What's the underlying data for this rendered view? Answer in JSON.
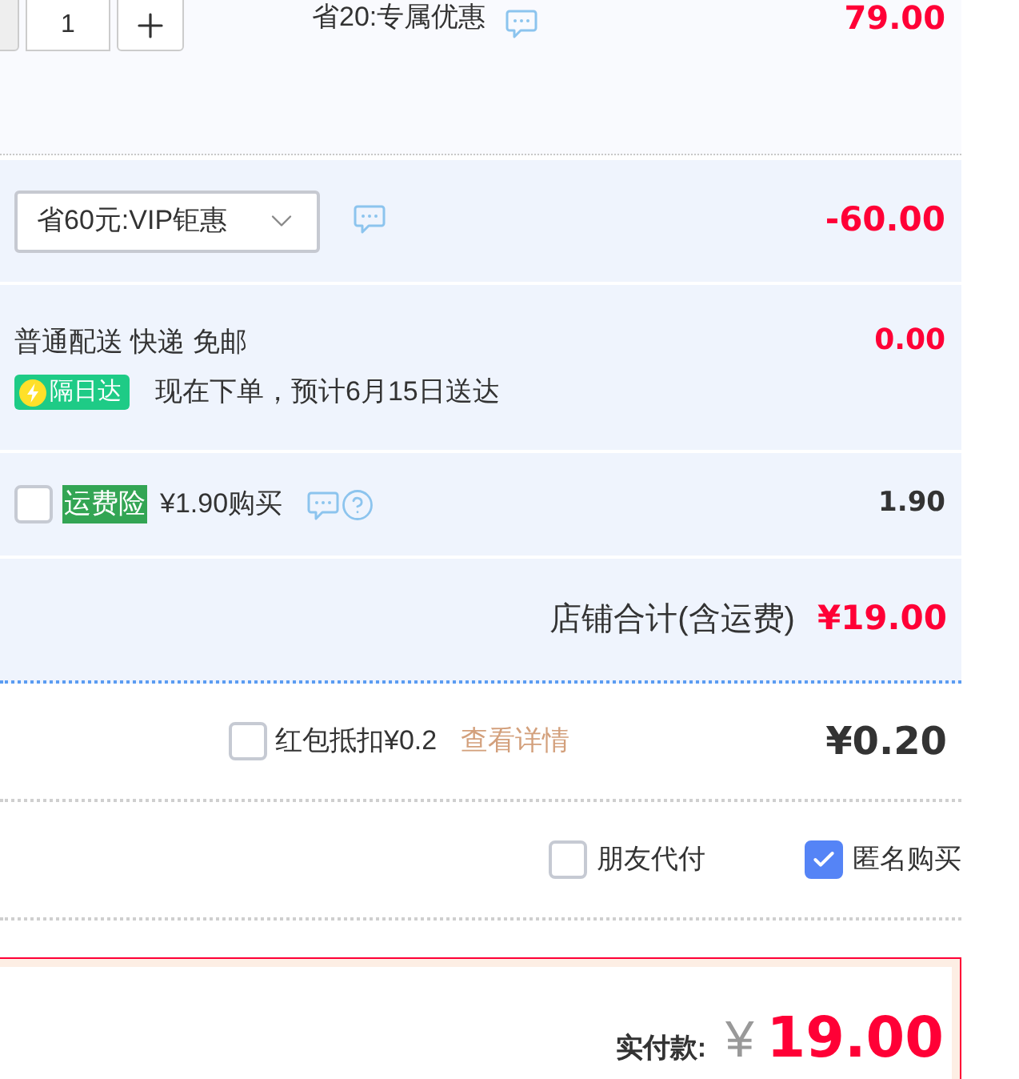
{
  "product_row": {
    "quantity": "1",
    "promo": "省20:专属优惠",
    "price": "79.00"
  },
  "shop_discount": {
    "selected_option": "省60元:VIP钜惠",
    "amount": "-60.00"
  },
  "delivery": {
    "method": "普通配送 快递 免邮",
    "badge": "隔日达",
    "eta": "现在下单，预计6月15日送达",
    "fee": "0.00"
  },
  "shipping_insurance": {
    "checked": false,
    "tag": "运费险",
    "offer": "¥1.90购买",
    "amount": "1.90"
  },
  "shop_total": {
    "label": "店铺合计(含运费)",
    "amount": "¥19.00"
  },
  "red_packet": {
    "checked": false,
    "label": "红包抵扣¥0.2",
    "link": "查看详情",
    "amount": "¥0.20"
  },
  "options": [
    {
      "label": "朋友代付",
      "checked": false
    },
    {
      "label": "匿名购买",
      "checked": true
    }
  ],
  "payment": {
    "label": "实付款:",
    "currency": "¥",
    "amount": "19.00"
  }
}
